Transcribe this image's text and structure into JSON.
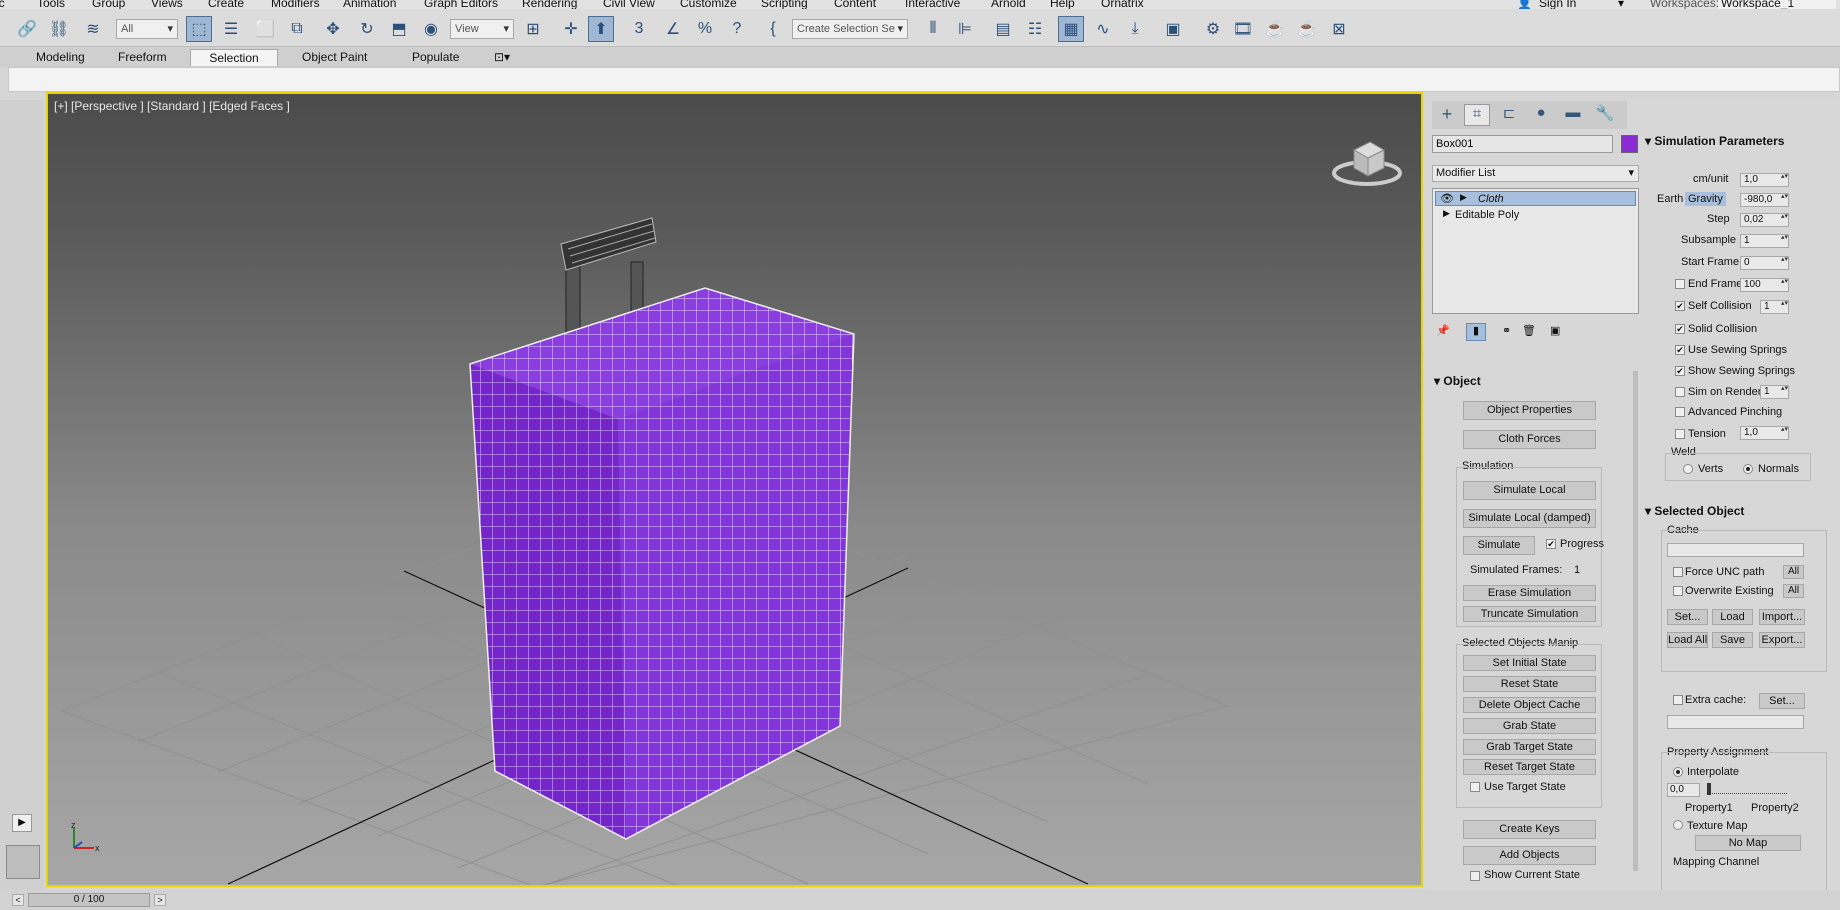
{
  "menu": [
    "Tools",
    "Group",
    "Views",
    "Create",
    "Modifiers",
    "Animation",
    "Graph Editors",
    "Rendering",
    "Civil View",
    "Customize",
    "Scripting",
    "Content",
    "Interactive",
    "Arnold",
    "Help",
    "Ornatrix"
  ],
  "account": {
    "sign_in": "Sign In",
    "workspaces_label": "Workspaces:",
    "workspace": "Workspace_1"
  },
  "toolbar": {
    "filter": "All",
    "ref_coord": "View",
    "named_selection": "Create Selection Se"
  },
  "ribbon_tabs": [
    "Modeling",
    "Freeform",
    "Selection",
    "Object Paint",
    "Populate"
  ],
  "viewport": {
    "label": "[+] [Perspective ] [Standard ] [Edged Faces ]",
    "object_color": "#7b2fc4"
  },
  "command_panel": {
    "object_name": "Box001",
    "object_color": "#8a2bd6",
    "modifier_list": "Modifier List",
    "stack": [
      "Cloth",
      "Editable Poly"
    ]
  },
  "object_rollout": {
    "title": "Object",
    "object_properties": "Object Properties",
    "cloth_forces": "Cloth Forces",
    "simulation_group": "Simulation",
    "simulate_local": "Simulate Local",
    "simulate_local_damped": "Simulate Local (damped)",
    "simulate": "Simulate",
    "progress": "Progress",
    "simulated_frames_label": "Simulated Frames:",
    "simulated_frames": "1",
    "erase_simulation": "Erase Simulation",
    "truncate_simulation": "Truncate Simulation",
    "manip_group": "Selected Objects Manip",
    "set_initial_state": "Set Initial State",
    "reset_state": "Reset State",
    "delete_object_cache": "Delete Object Cache",
    "grab_state": "Grab State",
    "grab_target_state": "Grab Target State",
    "reset_target_state": "Reset Target State",
    "use_target_state": "Use Target State",
    "create_keys": "Create Keys",
    "add_objects": "Add Objects",
    "show_current_state": "Show Current State"
  },
  "sim_params": {
    "title": "Simulation Parameters",
    "cm_unit_label": "cm/unit",
    "cm_unit": "1,0",
    "earth": "Earth",
    "gravity": "Gravity",
    "gravity_value": "-980,0",
    "step_label": "Step",
    "step": "0,02",
    "subsample_label": "Subsample",
    "subsample": "1",
    "start_frame_label": "Start Frame",
    "start_frame": "0",
    "end_frame_label": "End Frame",
    "end_frame": "100",
    "self_collision": "Self Collision",
    "self_collision_value": "1",
    "solid_collision": "Solid Collision",
    "use_sewing_springs": "Use Sewing Springs",
    "show_sewing_springs": "Show Sewing Springs",
    "sim_on_render": "Sim on Render",
    "sim_on_render_value": "1",
    "advanced_pinching": "Advanced Pinching",
    "tension": "Tension",
    "tension_value": "1,0",
    "weld_group": "Weld",
    "verts": "Verts",
    "normals": "Normals"
  },
  "selected_object": {
    "title": "Selected Object",
    "cache_group": "Cache",
    "force_unc": "Force UNC path",
    "overwrite_existing": "Overwrite Existing",
    "all": "All",
    "set": "Set...",
    "load": "Load",
    "import": "Import...",
    "load_all": "Load All",
    "save": "Save",
    "export": "Export...",
    "extra_cache": "Extra cache:",
    "extra_set": "Set...",
    "property_assignment": "Property Assignment",
    "interpolate": "Interpolate",
    "interp_value": "0,0",
    "property1": "Property1",
    "property2": "Property2",
    "texture_map": "Texture Map",
    "no_map": "No Map",
    "mapping_channel": "Mapping Channel"
  },
  "timeline": {
    "frame": "0 / 100"
  }
}
